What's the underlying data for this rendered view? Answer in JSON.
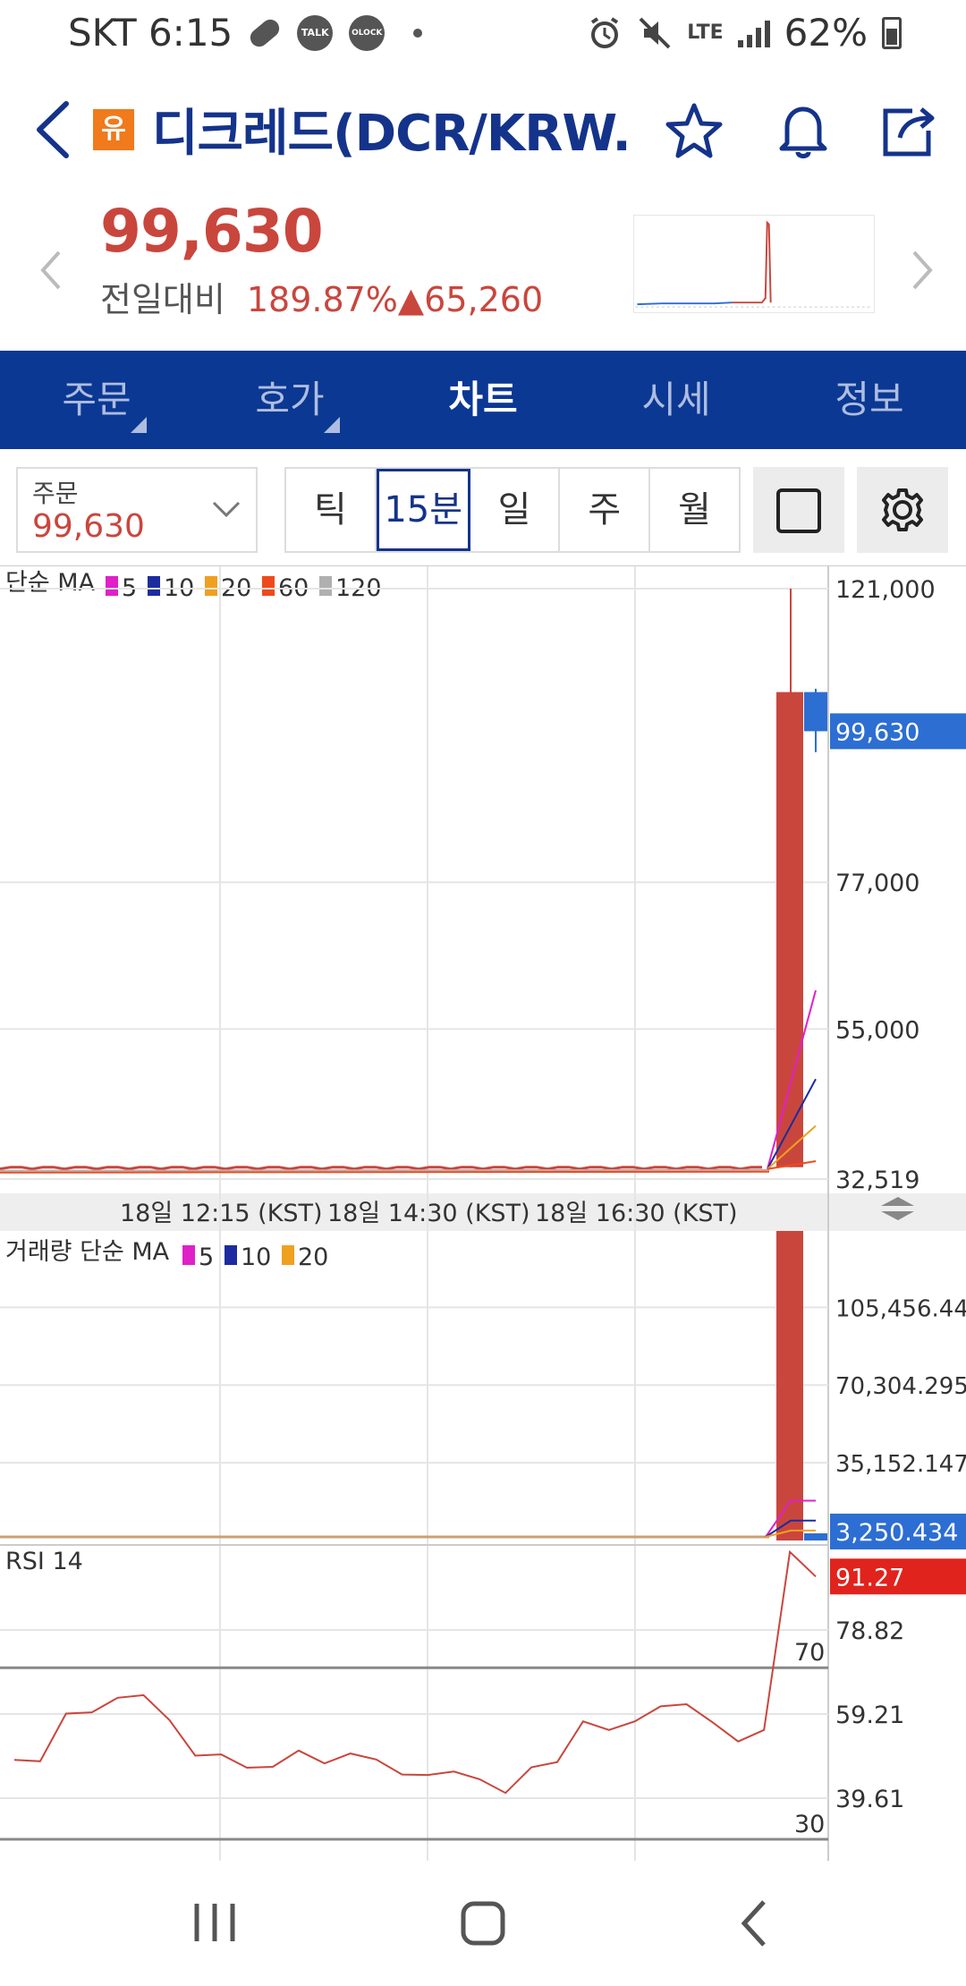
{
  "status_bar": {
    "carrier_time": "SKT 6:15",
    "icons": [
      "pill-icon",
      "talk-icon",
      "lock-icon",
      "dot-icon"
    ],
    "talk_label": "TALK",
    "lock_label": "OLOCK",
    "network": "LTE",
    "battery": "62%"
  },
  "header": {
    "badge": "유",
    "title": "디크레드(DCR/KRW...",
    "icons": [
      "back-arrow-icon",
      "star-icon",
      "bell-icon",
      "share-icon"
    ]
  },
  "price": {
    "current": "99,630",
    "compare_label": "전일대비",
    "change_rate": "189.87%",
    "change_arrow": "▲",
    "change_amount": "65,260"
  },
  "tabs": [
    {
      "label": "주문",
      "active": false,
      "has_menu": true
    },
    {
      "label": "호가",
      "active": false,
      "has_menu": true
    },
    {
      "label": "차트",
      "active": true,
      "has_menu": false
    },
    {
      "label": "시세",
      "active": false,
      "has_menu": false
    },
    {
      "label": "정보",
      "active": false,
      "has_menu": false
    }
  ],
  "controls": {
    "order_label": "주문",
    "order_value": "99,630",
    "periods": [
      {
        "label": "틱",
        "active": false
      },
      {
        "label": "15분",
        "active": true
      },
      {
        "label": "일",
        "active": false
      },
      {
        "label": "주",
        "active": false
      },
      {
        "label": "월",
        "active": false
      }
    ]
  },
  "colors": {
    "up": "#c9463d",
    "down": "#2d6ed2",
    "primary": "#0b3893",
    "ma5": "#e020c8",
    "ma10": "#1c2ca0",
    "ma20": "#f0a020",
    "ma60": "#f04a1c",
    "ma120": "#b0b0b0",
    "rsi": "#c9463d"
  },
  "chart_data": [
    {
      "type": "candlestick",
      "title": "단순 MA",
      "legend": [
        {
          "name": "5",
          "color": "#e020c8"
        },
        {
          "name": "10",
          "color": "#1c2ca0"
        },
        {
          "name": "20",
          "color": "#f0a020"
        },
        {
          "name": "60",
          "color": "#f04a1c"
        },
        {
          "name": "120",
          "color": "#b0b0b0"
        }
      ],
      "y_ticks": [
        "121,000",
        "77,000",
        "55,000",
        "32,519"
      ],
      "y_tick_values": [
        121000,
        77000,
        55000,
        32519
      ],
      "current_label": "99,630",
      "current_value": 99630,
      "ylim": [
        32519,
        121000
      ],
      "baseline_value": 34300,
      "big_candle": {
        "open": 34300,
        "high": 121000,
        "low": 34300,
        "close": 105500
      },
      "last_candle": {
        "open": 105500,
        "high": 106000,
        "low": 96500,
        "close": 99630
      },
      "ma_end_values": {
        "ma5": 60800,
        "ma10": 47500,
        "ma20": 40500,
        "ma60": 35200,
        "ma120": 34700
      },
      "x_labels": [
        "18일 12:15 (KST)",
        "18일 14:30 (KST)",
        "18일 16:30 (KST)"
      ]
    },
    {
      "type": "bar",
      "title": "거래량 단순 MA",
      "legend": [
        {
          "name": "5",
          "color": "#e020c8"
        },
        {
          "name": "10",
          "color": "#1c2ca0"
        },
        {
          "name": "20",
          "color": "#f0a020"
        }
      ],
      "y_ticks": [
        "105,456.442",
        "70,304.295",
        35152.147
      ],
      "y_ticks_text": [
        "105,456.442",
        "70,304.295",
        "35,152.147"
      ],
      "y_tick_values": [
        105456.442,
        70304.295,
        35152.147
      ],
      "current_label": "3,250.434",
      "current_value": 3250.434,
      "ylim": [
        0,
        140000
      ],
      "big_bar_value": 140000,
      "ma_end_values": {
        "ma5": 18000,
        "ma10": 9000,
        "ma20": 4500
      }
    },
    {
      "type": "line",
      "title": "RSI 14",
      "y_ticks": [
        "78.82",
        "59.21",
        "39.61"
      ],
      "y_tick_values": [
        78.82,
        59.21,
        39.61
      ],
      "levels": [
        {
          "label": "70",
          "value": 70
        },
        {
          "label": "30",
          "value": 30
        }
      ],
      "current_label": "91.27",
      "current_value": 91.27,
      "ylim": [
        25,
        98
      ],
      "values": [
        48.5,
        48.2,
        59.3,
        59.6,
        63.0,
        63.6,
        57.8,
        49.5,
        49.8,
        46.7,
        46.9,
        50.7,
        47.7,
        50.0,
        48.6,
        45.1,
        45.0,
        45.8,
        44.0,
        40.8,
        46.8,
        48.0,
        57.5,
        55.5,
        57.5,
        61.0,
        61.5,
        57.3,
        52.8,
        55.5,
        97.0,
        91.27
      ]
    }
  ],
  "navbar": {
    "icons": [
      "recent-apps-icon",
      "home-icon",
      "nav-back-icon"
    ]
  }
}
